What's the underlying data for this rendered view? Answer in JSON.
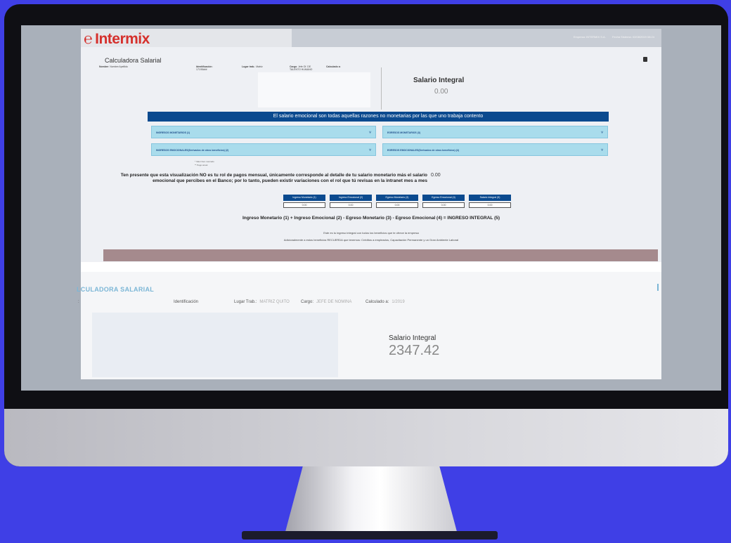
{
  "header": {
    "brand": "Intermix",
    "brand_symbol": "℮",
    "top_info": [
      "Empresa: INTERMIX S.A.",
      "Fecha Sistema: 02/08/2019 08:24"
    ]
  },
  "calc": {
    "title": "Calculadora Salarial",
    "fields": [
      {
        "label": "Nombre",
        "value": "Nombre Apellido"
      },
      {
        "label": "Identificación",
        "value": "17195###"
      },
      {
        "label": "Lugar trab.",
        "value": "Matriz"
      },
      {
        "label": "Cargo",
        "value": "Jefe Of. DE TALENTO HUMANO"
      },
      {
        "label": "Calculado a",
        "value": ""
      }
    ],
    "salary_label": "Salario Integral",
    "salary_value": "0.00",
    "banner": "El salario emocional son todas aquellas razones no monetarias por las que uno trabaja contento",
    "sections": [
      "INGRESOS MONETARIOS (1)",
      "EGRESOS MONETARIOS (3)",
      "INGRESOS EMOCIONALES(Derivados de otros beneficios) (2)",
      "EGRESOS EMOCIONALES(Derivados de otros beneficios) (4)"
    ],
    "legend": [
      "* Valor bien mercado",
      "** Pago anual"
    ],
    "notice": "Ten presente que esta visualización NO es tu rol de pagos mensual, únicamente corresponde al detalle de tu salario monetario más el salario emocional que percibes en el Banco; por lo tanto, pueden existir variaciones con el rol que tú revisas en la intranet mes a mes",
    "notice_value": "0.00",
    "buttons": [
      "Ingreso Monetario (1)",
      "Ingreso Emocional (2)",
      "Egreso Monetario (3)",
      "Egreso Emocional (4)",
      "Salario Integral (5)"
    ],
    "values": [
      "0.00",
      "0.00",
      "0.00",
      "0.00",
      "0.00"
    ],
    "formula": "Ingreso Monetario (1) + Ingreso Emocional (2) - Egreso Monetario (3) - Egreso Emocional (4) = INGRESO INTEGRAL (5)",
    "desc1": "Este es tu ingreso integral con todos los beneficios que te ofrece la empresa",
    "desc2": "Adicionalmente a estos beneficios RECUERDA que tenemos: Créditos a empleados, Capacitación Permanente y un Gran Ambiente Laboral"
  },
  "second": {
    "title": "LCULADORA SALARIAL",
    "field0": ":",
    "field1_label": "Identificación",
    "field2_label": "Lugar Trab.:",
    "field2_value": "MATRIZ QUITO",
    "field3_label": "Cargo:",
    "field3_value": "JEFE DE NOMINA",
    "field4_label": "Calculado a:",
    "field4_value": "1/2019",
    "salary_label": "Salario Integral",
    "salary_value": "2347.42"
  }
}
